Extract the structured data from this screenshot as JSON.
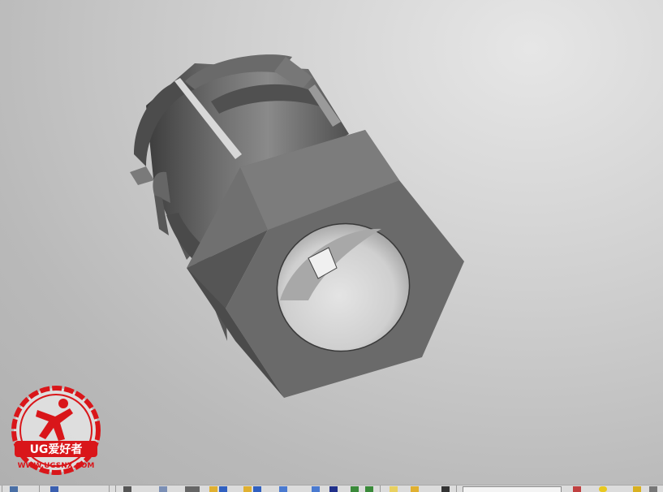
{
  "app": {
    "view": "3d-model-viewport"
  },
  "colors": {
    "background": "#c4c4c4",
    "part": "#5a5a5a",
    "bore": "#d6d6d6",
    "watermark_red": "#d9161a"
  },
  "watermark": {
    "brand": "UG爱好者",
    "url": "WWW.UGSNX.COM"
  },
  "toolbar": {
    "icons": [
      "snap-icon",
      "view-icon",
      "layer-icon",
      "folder-plus-icon",
      "folder-arrow-icon",
      "rotate-icon",
      "selection-icon",
      "filter-icon",
      "file-icon",
      "pin-icon",
      "file-lock-icon",
      "slider-icon",
      "crop-icon",
      "smile-icon",
      "lock-icon",
      "cursor-icon"
    ]
  }
}
